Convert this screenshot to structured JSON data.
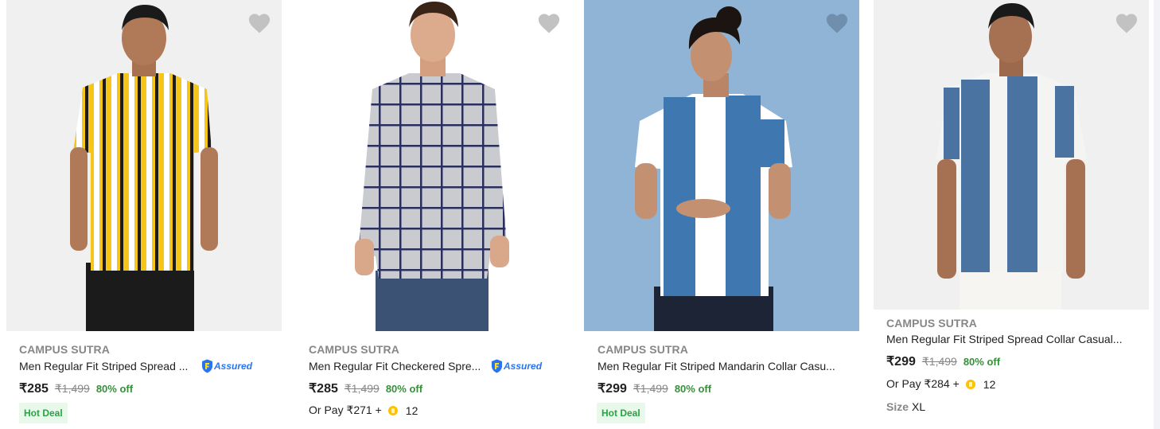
{
  "products": [
    {
      "brand": "CAMPUS SUTRA",
      "title": "Men Regular Fit Striped Spread ...",
      "assured_label": "Assured",
      "price": "₹285",
      "mrp": "₹1,499",
      "discount": "80% off",
      "badge": "Hot Deal",
      "wishlist_icon": "heart-icon"
    },
    {
      "brand": "CAMPUS SUTRA",
      "title": "Men Regular Fit Checkered Spre...",
      "assured_label": "Assured",
      "price": "₹285",
      "mrp": "₹1,499",
      "discount": "80% off",
      "or_pay": "Or Pay ₹271 +",
      "coins": "12",
      "wishlist_icon": "heart-icon"
    },
    {
      "brand": "CAMPUS SUTRA",
      "title": "Men Regular Fit Striped Mandarin Collar Casu...",
      "price": "₹299",
      "mrp": "₹1,499",
      "discount": "80% off",
      "badge": "Hot Deal",
      "wishlist_icon": "heart-icon"
    },
    {
      "brand": "CAMPUS SUTRA",
      "title": "Men Regular Fit Striped Spread Collar Casual...",
      "price": "₹299",
      "mrp": "₹1,499",
      "discount": "80% off",
      "or_pay": "Or Pay ₹284 +",
      "coins": "12",
      "size_label": "Size",
      "size_value": "XL",
      "wishlist_icon": "heart-icon"
    }
  ],
  "colors": {
    "brand_text": "#878787",
    "discount_green": "#388e3c",
    "hot_deal_bg": "#e8f8ea",
    "assured_blue": "#2874f0",
    "coin_yellow": "#ffc200"
  }
}
